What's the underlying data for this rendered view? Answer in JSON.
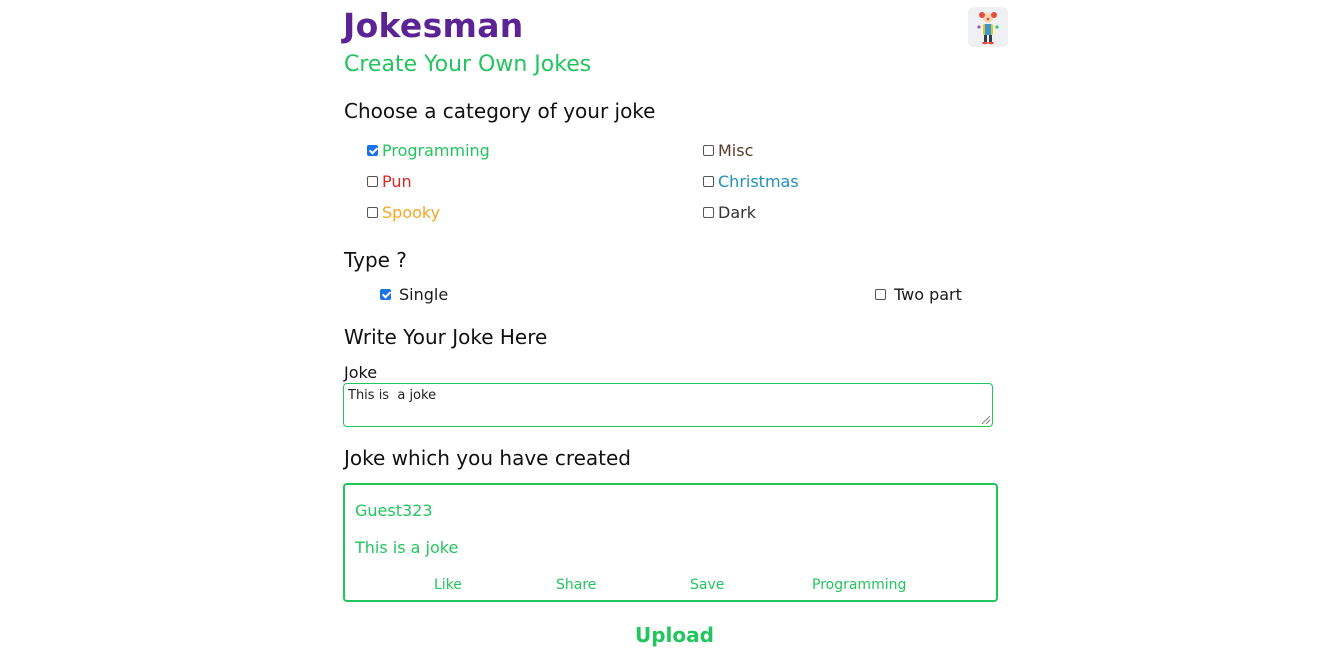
{
  "header": {
    "title": "Jokesman",
    "subtitle": "Create Your Own Jokes",
    "avatar_icon": "clown-icon"
  },
  "category": {
    "heading": "Choose a category of your joke",
    "options": [
      {
        "label": "Programming",
        "checked": true,
        "color": "#22c55e"
      },
      {
        "label": "Misc",
        "checked": false,
        "color": "#5a3a2a"
      },
      {
        "label": "Pun",
        "checked": false,
        "color": "#dc2626"
      },
      {
        "label": "Christmas",
        "checked": false,
        "color": "#1e90b8"
      },
      {
        "label": "Spooky",
        "checked": false,
        "color": "#f5a623"
      },
      {
        "label": "Dark",
        "checked": false,
        "color": "#333333"
      }
    ]
  },
  "type": {
    "heading": "Type ?",
    "options": [
      {
        "label": "Single",
        "checked": true
      },
      {
        "label": "Two part",
        "checked": false
      }
    ]
  },
  "write": {
    "heading": "Write Your Joke Here",
    "field_label": "Joke",
    "value": "This is  a joke"
  },
  "preview": {
    "heading": "Joke which you have created",
    "user": "Guest323",
    "text": "This is a joke",
    "actions": [
      "Like",
      "Share",
      "Save",
      "Programming"
    ]
  },
  "upload_label": "Upload",
  "colors": {
    "brand_purple": "#5b2393",
    "accent_green": "#22c55e",
    "checkbox_blue": "#1a73e8"
  }
}
